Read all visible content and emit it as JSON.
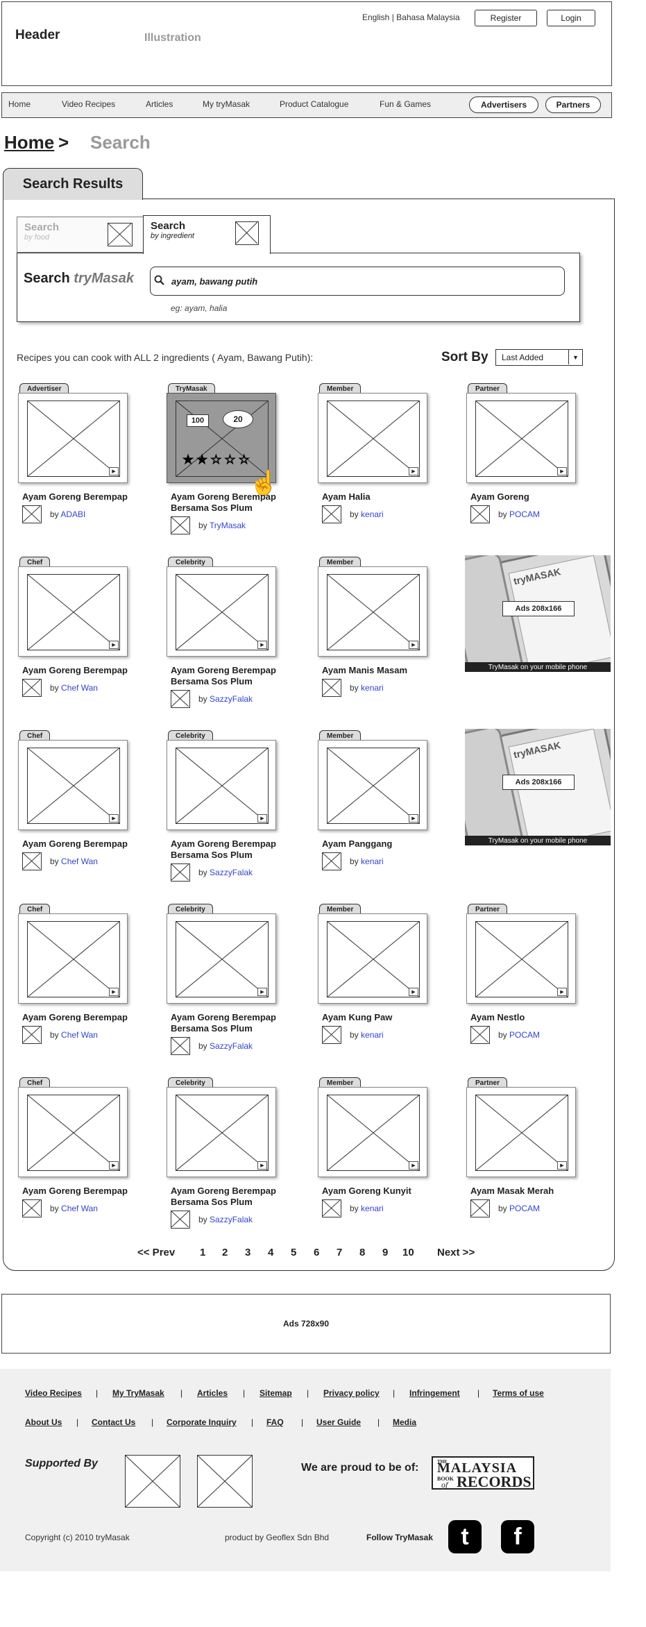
{
  "header": {
    "title": "Header",
    "illustration": "Illustration",
    "languages": "English | Bahasa Malaysia",
    "register": "Register",
    "login": "Login"
  },
  "nav": {
    "items": [
      "Home",
      "Video Recipes",
      "Articles",
      "My tryMasak",
      "Product Catalogue",
      "Fun & Games"
    ],
    "advertisers": "Advertisers",
    "partners": "Partners"
  },
  "breadcrumb": {
    "home": "Home",
    "separator": ">",
    "current": "Search"
  },
  "results_tab": "Search Results",
  "search": {
    "tab_food": {
      "title": "Search",
      "subtitle": "by food"
    },
    "tab_ingredient": {
      "title": "Search",
      "subtitle": "by ingredient"
    },
    "label_prefix": "Search",
    "label_brand": "tryMasak",
    "value": "ayam, bawang putih",
    "hint": "eg: ayam, halia"
  },
  "results_summary": "Recipes you can cook with ALL 2 ingredients ( Ayam, Bawang Putih):",
  "sort": {
    "label": "Sort By",
    "selected": "Last Added"
  },
  "featured": {
    "score": "100",
    "comments": "20",
    "rating": 2,
    "rating_max": 5
  },
  "rows": [
    [
      {
        "badge": "Advertiser",
        "title": [
          "Ayam Goreng Berempap"
        ],
        "author": "ADABI"
      },
      {
        "badge": "TryMasak",
        "title": [
          "Ayam Goreng Berempap",
          "Bersama Sos Plum"
        ],
        "author": "TryMasak",
        "featured": true
      },
      {
        "badge": "Member",
        "title": [
          "Ayam Halia"
        ],
        "author": "kenari"
      },
      {
        "badge": "Partner",
        "title": [
          "Ayam Goreng"
        ],
        "author": "POCAM"
      }
    ],
    [
      {
        "badge": "Chef",
        "title": [
          "Ayam Goreng Berempap"
        ],
        "author": "Chef Wan"
      },
      {
        "badge": "Celebrity",
        "title": [
          "Ayam Goreng Berempap",
          "Bersama Sos Plum"
        ],
        "author": "SazzyFalak"
      },
      {
        "badge": "Member",
        "title": [
          "Ayam Manis Masam"
        ],
        "author": "kenari"
      },
      {
        "ad": true,
        "label": "Ads 208x166",
        "caption": "TryMasak on your mobile phone"
      }
    ],
    [
      {
        "badge": "Chef",
        "title": [
          "Ayam Goreng Berempap"
        ],
        "author": "Chef Wan"
      },
      {
        "badge": "Celebrity",
        "title": [
          "Ayam Goreng Berempap",
          "Bersama Sos Plum"
        ],
        "author": "SazzyFalak"
      },
      {
        "badge": "Member",
        "title": [
          "Ayam Panggang"
        ],
        "author": "kenari"
      },
      {
        "ad": true,
        "label": "Ads 208x166",
        "caption": "TryMasak on your mobile phone"
      }
    ],
    [
      {
        "badge": "Chef",
        "title": [
          "Ayam Goreng Berempap"
        ],
        "author": "Chef Wan"
      },
      {
        "badge": "Celebrity",
        "title": [
          "Ayam Goreng Berempap",
          "Bersama Sos Plum"
        ],
        "author": "SazzyFalak"
      },
      {
        "badge": "Member",
        "title": [
          "Ayam Kung Paw"
        ],
        "author": "kenari"
      },
      {
        "badge": "Partner",
        "title": [
          "Ayam Nestlo"
        ],
        "author": "POCAM"
      }
    ],
    [
      {
        "badge": "Chef",
        "title": [
          "Ayam Goreng Berempap"
        ],
        "author": "Chef Wan"
      },
      {
        "badge": "Celebrity",
        "title": [
          "Ayam Goreng Berempap",
          "Bersama Sos Plum"
        ],
        "author": "SazzyFalak"
      },
      {
        "badge": "Member",
        "title": [
          "Ayam Goreng Kunyit"
        ],
        "author": "kenari"
      },
      {
        "badge": "Partner",
        "title": [
          "Ayam Masak Merah"
        ],
        "author": "POCAM"
      }
    ]
  ],
  "by_prefix": "by",
  "ad_phone_brand": "tryMASAK",
  "pagination": {
    "prev": "<< Prev",
    "pages": [
      "1",
      "2",
      "3",
      "4",
      "5",
      "6",
      "7",
      "8",
      "9",
      "10"
    ],
    "next": "Next >>"
  },
  "ad_728": "Ads 728x90",
  "footer": {
    "links_row1": [
      "Video Recipes",
      "My TryMasak",
      "Articles",
      "Sitemap",
      "Privacy policy",
      "Infringement",
      "Terms of use"
    ],
    "links_row2": [
      "About Us",
      "Contact Us",
      "Corporate Inquiry",
      "FAQ",
      "User Guide",
      "Media"
    ],
    "separator": "|",
    "supported_by": "Supported By",
    "proud": "We are proud to be of:",
    "mbr_lines": [
      "THE",
      "MALAYSIA",
      "BOOK",
      "of",
      "RECORDS"
    ],
    "copyright": "Copyright (c) 2010 tryMasak",
    "product_by": "product by Geoflex Sdn Bhd",
    "follow": "Follow TryMasak",
    "twitter": "t",
    "facebook": "f"
  }
}
